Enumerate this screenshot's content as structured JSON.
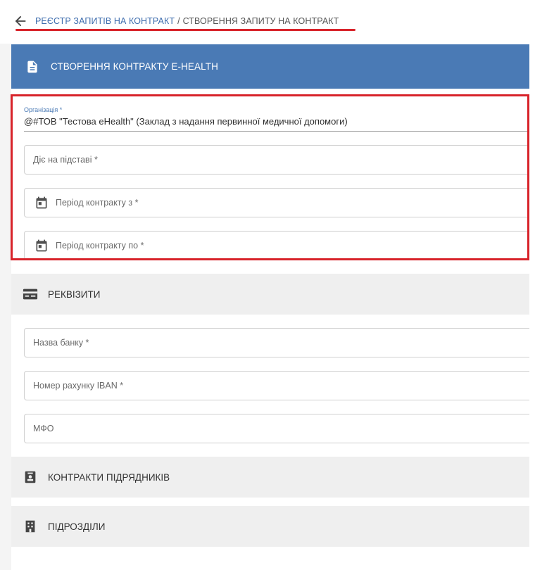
{
  "breadcrumb": {
    "registry_link": "РЕЄСТР ЗАПИТІВ НА КОНТРАКТ",
    "separator": "/",
    "current": "СТВОРЕННЯ ЗАПИТУ НА КОНТРАКТ"
  },
  "panel": {
    "title": "СТВОРЕННЯ КОНТРАКТУ E-HEALTH",
    "icon": "document-icon"
  },
  "form": {
    "organization_label": "Організація *",
    "organization_value": "@#ТОВ \"Тестова eHealth\" (Заклад з надання первинної медичної допомоги)",
    "basis_placeholder": "Діє на підставі *",
    "period_from_placeholder": "Період контракту з *",
    "period_to_placeholder": "Період контракту по *"
  },
  "sections": {
    "requisites": {
      "title": "РЕКВІЗИТИ",
      "icon": "credit-card-icon",
      "bank_name_placeholder": "Назва банку *",
      "iban_placeholder": "Номер рахунку IBAN *",
      "mfo_placeholder": "МФО"
    },
    "contractors": {
      "title": "КОНТРАКТИ ПІДРЯДНИКІВ",
      "icon": "badge-icon"
    },
    "divisions": {
      "title": "ПІДРОЗДІЛИ",
      "icon": "building-icon"
    }
  },
  "colors": {
    "primary": "#4a7ab5",
    "link": "#3d6cad",
    "highlight": "#d8232a",
    "section_bg": "#efefef"
  }
}
